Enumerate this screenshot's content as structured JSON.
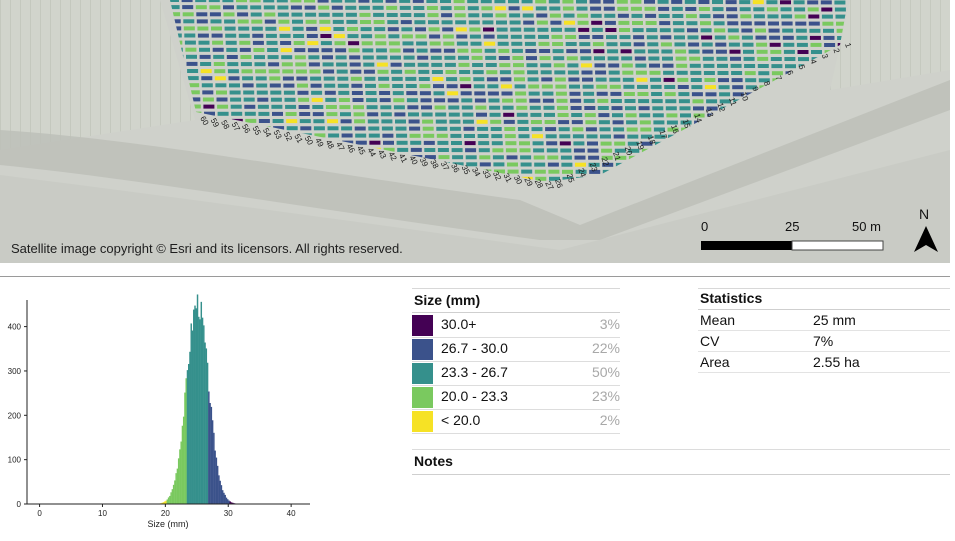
{
  "map": {
    "copyright": "Satellite image copyright © Esri and its licensors. All rights reserved.",
    "scalebar": {
      "ticks": [
        "0",
        "25",
        "50 m"
      ]
    },
    "north_label": "N",
    "row_labels_bottom": [
      "60",
      "59",
      "58",
      "57",
      "56",
      "55",
      "54",
      "53",
      "52",
      "51",
      "50",
      "49",
      "48",
      "47",
      "46",
      "45",
      "44",
      "43",
      "42",
      "41",
      "40",
      "39",
      "38",
      "37",
      "36",
      "35",
      "34",
      "33",
      "32",
      "31",
      "30",
      "29",
      "28",
      "27",
      "26",
      "25",
      "24",
      "23",
      "22",
      "21",
      "20",
      "19",
      "18",
      "17",
      "16",
      "15",
      "14",
      "13",
      "12",
      "11",
      "10",
      "9",
      "8",
      "7",
      "6",
      "5",
      "4",
      "3",
      "2",
      "1"
    ]
  },
  "legend": {
    "title": "Size (mm)",
    "items": [
      {
        "label": "30.0+",
        "percent": "3%",
        "color": "#440154"
      },
      {
        "label": "26.7 - 30.0",
        "percent": "22%",
        "color": "#3b528b"
      },
      {
        "label": "23.3 - 26.7",
        "percent": "50%",
        "color": "#35908c"
      },
      {
        "label": "20.0 - 23.3",
        "percent": "23%",
        "color": "#7ac95f"
      },
      {
        "label": "< 20.0",
        "percent": "2%",
        "color": "#f6e225"
      }
    ]
  },
  "statistics": {
    "title": "Statistics",
    "rows": [
      {
        "label": "Mean",
        "value": "25 mm"
      },
      {
        "label": "CV",
        "value": "7%"
      },
      {
        "label": "Area",
        "value": "2.55 ha"
      }
    ]
  },
  "notes": {
    "title": "Notes"
  },
  "chart_data": {
    "type": "bar",
    "xlabel": "Size (mm)",
    "ylabel": "",
    "xlim": [
      -2,
      43
    ],
    "ylim": [
      0,
      460
    ],
    "xticks": [
      0,
      10,
      20,
      30,
      40
    ],
    "yticks": [
      0,
      100,
      200,
      300,
      400
    ],
    "bin_width_mm": 0.2,
    "color_breaks": [
      20.0,
      23.3,
      26.7,
      30.0
    ],
    "colors": [
      "#f6e225",
      "#7ac95f",
      "#35908c",
      "#3b528b",
      "#440154"
    ],
    "distribution": {
      "mean_mm": 25,
      "peak_count": 455
    }
  }
}
